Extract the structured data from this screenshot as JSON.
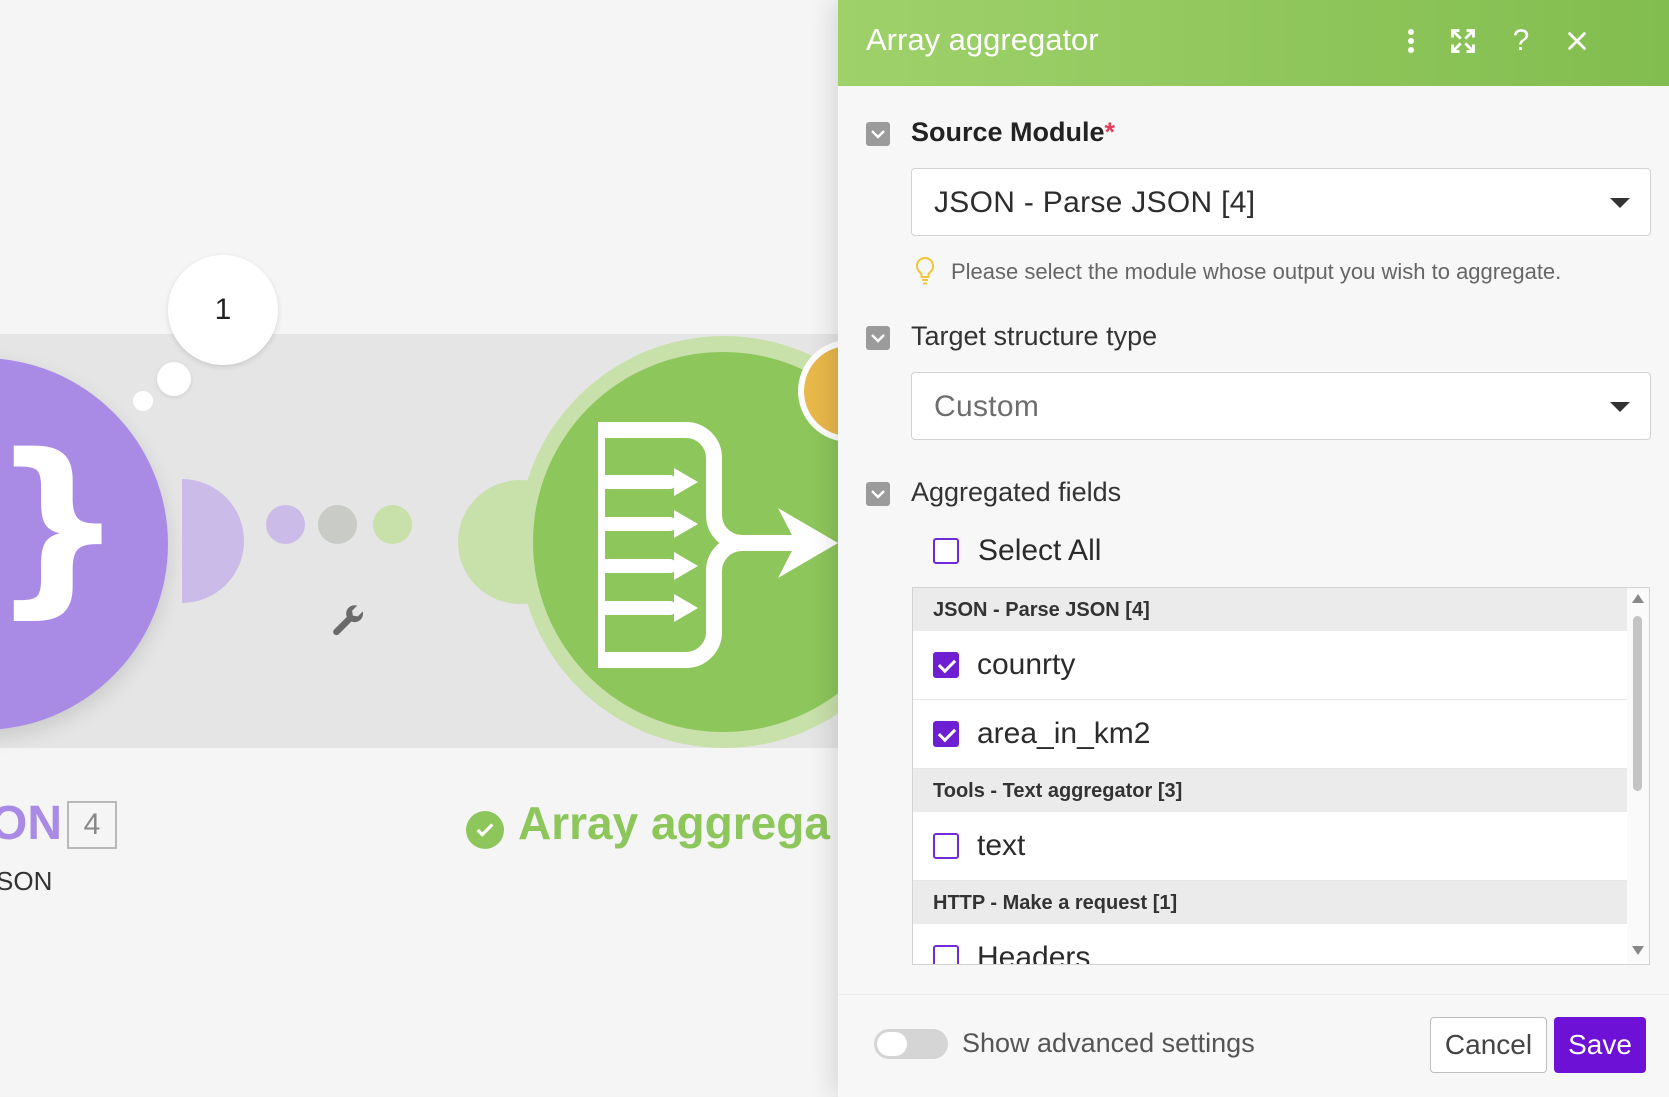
{
  "canvas": {
    "bubble_count": "1",
    "json_module": {
      "name_fragment": "ON",
      "badge": "4",
      "subtitle_fragment": "SON"
    },
    "aggregator_module": {
      "name_fragment": "Array aggrega"
    }
  },
  "panel": {
    "title": "Array aggregator",
    "header_icons": [
      "more-vertical-icon",
      "expand-icon",
      "help-icon",
      "close-icon"
    ],
    "source_module": {
      "label": "Source Module",
      "required_mark": "*",
      "value": "JSON - Parse JSON [4]",
      "hint": "Please select the module whose output you wish to aggregate."
    },
    "target_structure": {
      "label": "Target structure type",
      "value": "Custom"
    },
    "aggregated_fields": {
      "label": "Aggregated fields",
      "select_all": "Select All",
      "groups": [
        {
          "title": "JSON - Parse JSON [4]",
          "items": [
            {
              "label": "counrty",
              "checked": true
            },
            {
              "label": "area_in_km2",
              "checked": true
            }
          ]
        },
        {
          "title": "Tools - Text aggregator [3]",
          "items": [
            {
              "label": "text",
              "checked": false
            }
          ]
        },
        {
          "title": "HTTP - Make a request [1]",
          "items": [
            {
              "label": "Headers",
              "checked": false
            }
          ]
        }
      ]
    },
    "footer": {
      "advanced_toggle_label": "Show advanced settings",
      "cancel": "Cancel",
      "save": "Save"
    }
  },
  "colors": {
    "header_green": "#8dc65b",
    "save_purple": "#6d11d6",
    "json_module_purple": "#a98be6",
    "required_red": "#e0405a"
  }
}
